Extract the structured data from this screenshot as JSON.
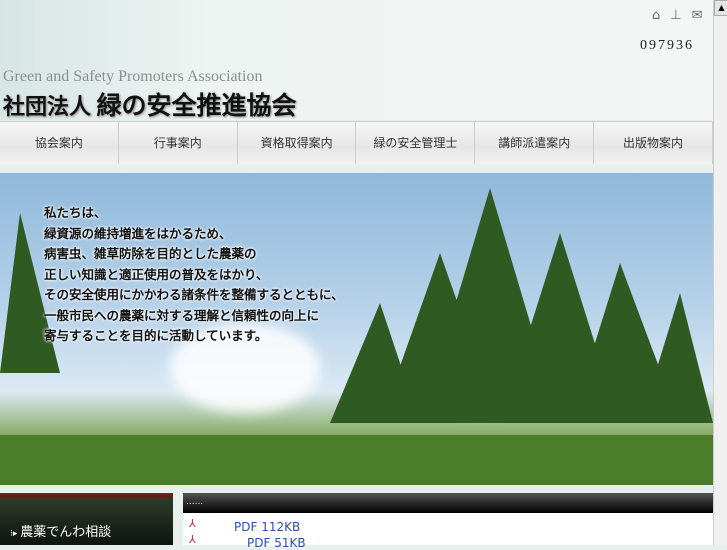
{
  "header": {
    "english_name": "Green and Safety Promoters Association",
    "prefix": "社団法人",
    "name": "緑の安全推進協会",
    "counter": "097936",
    "icons": [
      "home-icon",
      "sitemap-icon",
      "mail-icon"
    ]
  },
  "nav": [
    {
      "label": "協会案内"
    },
    {
      "label": "行事案内"
    },
    {
      "label": "資格取得案内"
    },
    {
      "label": "緑の安全管理士"
    },
    {
      "label": "講師派遣案内"
    },
    {
      "label": "出版物案内"
    }
  ],
  "hero": {
    "lines": [
      "私たちは、",
      "緑資源の維持増進をはかるため、",
      "病害虫、雑草防除を目的とした農薬の",
      "正しい知識と適正使用の普及をはかり、",
      "その安全使用にかかわる諸条件を整備するとともに、",
      "一般市民への農薬に対する理解と信頼性の向上に",
      "寄与することを目的に活動しています。"
    ]
  },
  "sidebar": {
    "link": "農薬でんわ相談"
  },
  "content": {
    "header": "......",
    "files": [
      {
        "label": "PDF 112KB"
      },
      {
        "label": "PDF 51KB"
      }
    ]
  }
}
